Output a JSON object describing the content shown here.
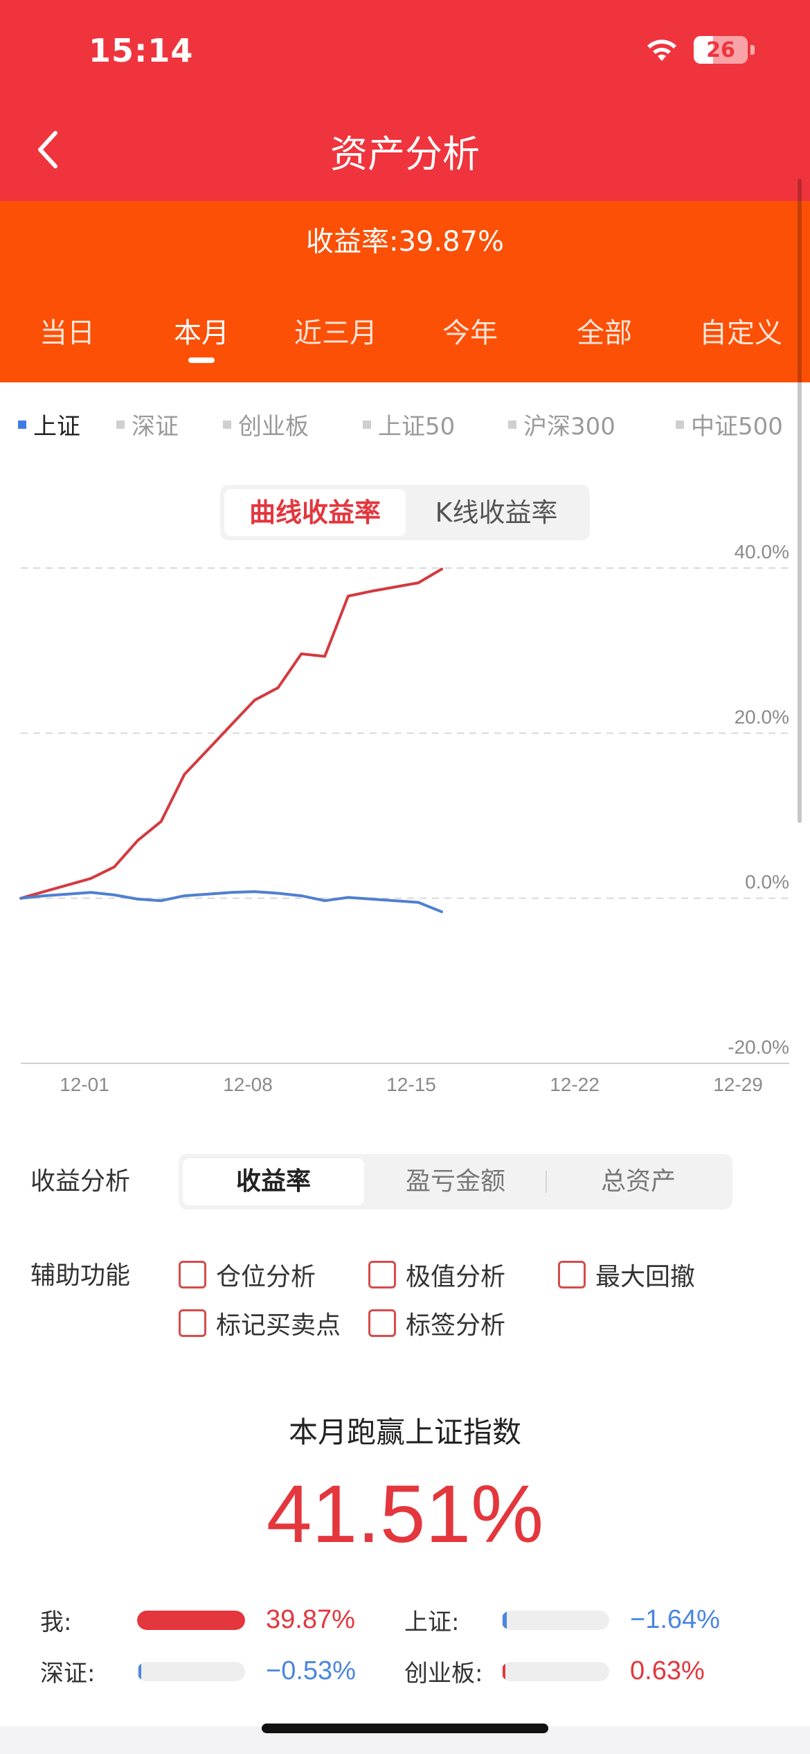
{
  "status": {
    "time": "15:14",
    "battery": "26"
  },
  "nav": {
    "title": "资产分析"
  },
  "summary": {
    "yield_text": "收益率:39.87%"
  },
  "periods": [
    "当日",
    "本月",
    "近三月",
    "今年",
    "全部",
    "自定义"
  ],
  "active_period": "本月",
  "indices": [
    "上证",
    "深证",
    "创业板",
    "上证50",
    "沪深300",
    "中证500"
  ],
  "active_index": "上证",
  "chart_toggle": {
    "curve": "曲线收益率",
    "kline": "K线收益率",
    "active": "曲线收益率"
  },
  "chart_data": {
    "type": "line",
    "y_tick_labels": [
      "40.0%",
      "20.0%",
      "0.0%",
      "-20.0%"
    ],
    "ylim": [
      -20,
      40
    ],
    "x_tick_labels": [
      "12-01",
      "12-08",
      "12-15",
      "12-22",
      "12-29"
    ],
    "xlim": [
      0,
      31
    ],
    "grid": true,
    "series": [
      {
        "color": "#d33a3f",
        "x": [
          0,
          1,
          2,
          3,
          4,
          5,
          6,
          7,
          8,
          9,
          10,
          11,
          12,
          13,
          14,
          15,
          16,
          17,
          18
        ],
        "values": [
          0,
          0.8,
          1.6,
          2.4,
          3.8,
          7.0,
          9.3,
          15.0,
          18.0,
          21.0,
          24.0,
          25.5,
          29.6,
          29.3,
          36.6,
          37.2,
          37.7,
          38.2,
          39.87
        ]
      },
      {
        "color": "#4f7fd0",
        "x": [
          0,
          1,
          2,
          3,
          4,
          5,
          6,
          7,
          8,
          9,
          10,
          11,
          12,
          13,
          14,
          15,
          16,
          17,
          18
        ],
        "values": [
          0,
          0.3,
          0.5,
          0.7,
          0.4,
          -0.1,
          -0.3,
          0.3,
          0.5,
          0.7,
          0.8,
          0.6,
          0.3,
          -0.3,
          0.1,
          -0.1,
          -0.3,
          -0.5,
          -1.64
        ]
      }
    ]
  },
  "analysis": {
    "label": "收益分析",
    "options": [
      "收益率",
      "盈亏金额",
      "总资产"
    ],
    "active": "收益率"
  },
  "aux": {
    "label": "辅助功能",
    "options": [
      "仓位分析",
      "极值分析",
      "最大回撤",
      "标记买卖点",
      "标签分析"
    ]
  },
  "beat": {
    "title": "本月跑赢上证指数",
    "value": "41.51%"
  },
  "comparisons": [
    {
      "name": "我:",
      "value": "39.87%",
      "progress": 1.0,
      "color": "#e3363d"
    },
    {
      "name": "上证:",
      "value": "−1.64%",
      "progress": 0.04,
      "color": "#4a86e0"
    },
    {
      "name": "深证:",
      "value": "−0.53%",
      "progress": 0.013,
      "color": "#4a86e0"
    },
    {
      "name": "创业板:",
      "value": "0.63%",
      "progress": 0.016,
      "color": "#e3363d"
    }
  ]
}
